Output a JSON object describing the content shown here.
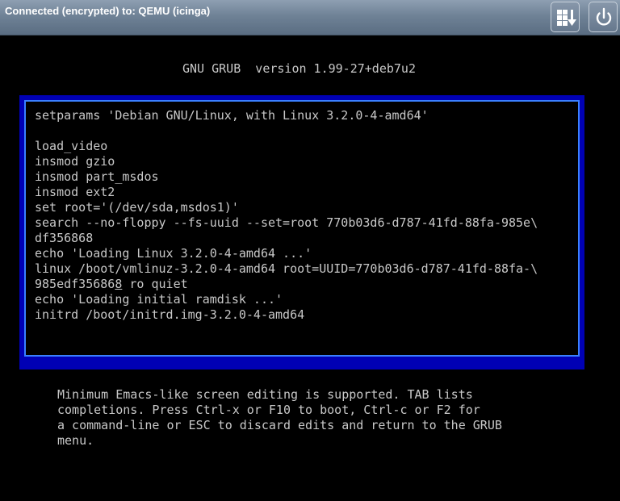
{
  "topbar": {
    "title": "Connected (encrypted) to: QEMU (icinga)",
    "send_keys_icon": "send-keys-icon",
    "power_icon": "power-icon"
  },
  "grub": {
    "header": "GNU GRUB  version 1.99-27+deb7u2",
    "edit_lines": [
      "setparams 'Debian GNU/Linux, with Linux 3.2.0-4-amd64'",
      "",
      "load_video",
      "insmod gzio",
      "insmod part_msdos",
      "insmod ext2",
      "set root='(/dev/sda,msdos1)'",
      "search --no-floppy --fs-uuid --set=root 770b03d6-d787-41fd-88fa-985e\\",
      "df356868",
      "echo 'Loading Linux 3.2.0-4-amd64 ...'",
      "linux /boot/vmlinuz-3.2.0-4-amd64 root=UUID=770b03d6-d787-41fd-88fa-\\",
      "985edf356868 ro quiet",
      "echo 'Loading initial ramdisk ...'",
      "initrd /boot/initrd.img-3.2.0-4-amd64"
    ],
    "help_lines": [
      "Minimum Emacs-like screen editing is supported. TAB lists",
      "completions. Press Ctrl-x or F10 to boot, Ctrl-c or F2 for",
      "a command-line or ESC to discard edits and return to the GRUB",
      "menu."
    ]
  },
  "colors": {
    "background": "#000000",
    "text": "#c8c8c8",
    "frame_blue": "#0000b4",
    "frame_border": "#3a7fff",
    "topbar": "#6f8296"
  }
}
